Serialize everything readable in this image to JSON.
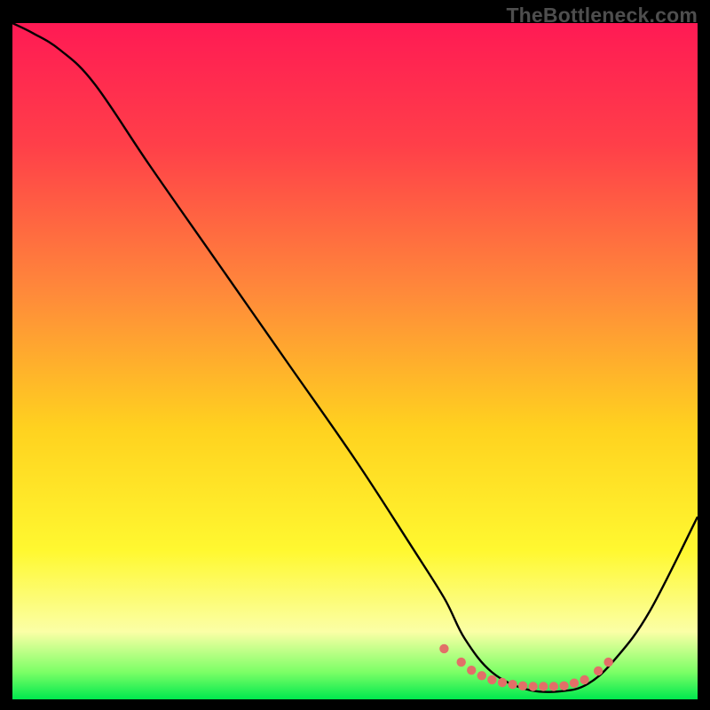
{
  "watermark": "TheBottleneck.com",
  "chart_data": {
    "type": "line",
    "title": "",
    "xlabel": "",
    "ylabel": "",
    "xlim": [
      0,
      100
    ],
    "ylim": [
      0,
      100
    ],
    "gradient_stops": [
      {
        "offset": 0,
        "color": "#ff1a54"
      },
      {
        "offset": 18,
        "color": "#ff3f49"
      },
      {
        "offset": 40,
        "color": "#ff8a3a"
      },
      {
        "offset": 60,
        "color": "#ffd21f"
      },
      {
        "offset": 78,
        "color": "#fff830"
      },
      {
        "offset": 90,
        "color": "#fbffa6"
      },
      {
        "offset": 96,
        "color": "#7bff66"
      },
      {
        "offset": 100,
        "color": "#00e84e"
      }
    ],
    "series": [
      {
        "name": "bottleneck-curve",
        "color": "#000000",
        "x": [
          0,
          3,
          7,
          12,
          20,
          30,
          40,
          50,
          58,
          63,
          66,
          70,
          75,
          80,
          84,
          88,
          93,
          100
        ],
        "y": [
          100,
          98.5,
          96,
          91,
          79,
          64.5,
          50,
          35.5,
          23,
          15,
          9,
          4,
          1.5,
          1.2,
          2.3,
          6,
          13,
          27
        ]
      }
    ],
    "markers": {
      "name": "optimal-range-dots",
      "color": "#e26f68",
      "x": [
        63,
        65.5,
        67,
        68.5,
        70,
        71.5,
        73,
        74.5,
        76,
        77.5,
        79,
        80.5,
        82,
        83.5,
        85.5,
        87
      ],
      "y": [
        7.5,
        5.5,
        4.3,
        3.5,
        2.9,
        2.5,
        2.2,
        2.0,
        1.9,
        1.9,
        1.9,
        2.0,
        2.4,
        2.9,
        4.2,
        5.5
      ]
    }
  }
}
